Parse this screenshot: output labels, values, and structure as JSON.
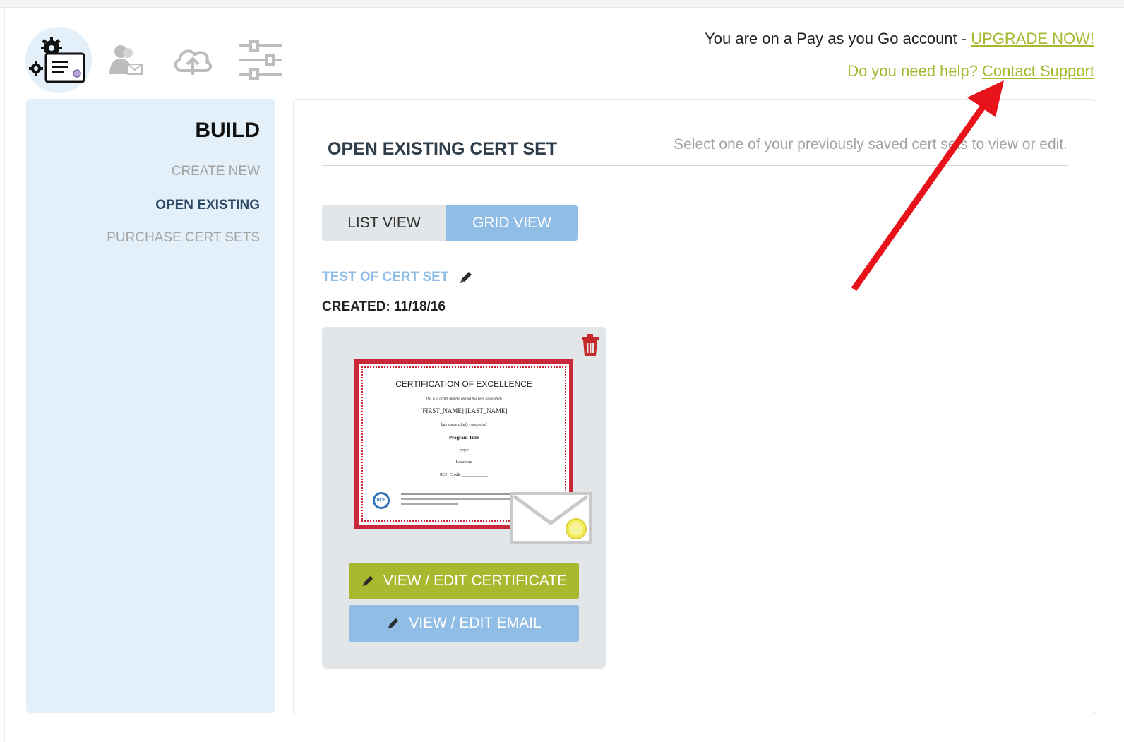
{
  "account": {
    "prefix": "You are on a Pay as you Go account - ",
    "upgrade_link": "UPGRADE NOW!"
  },
  "help": {
    "prefix": "Do you need help? ",
    "support_link": "Contact Support"
  },
  "nav": {
    "items": [
      {
        "icon": "build-certificate-icon",
        "active": true
      },
      {
        "icon": "recipients-icon",
        "active": false
      },
      {
        "icon": "cloud-upload-icon",
        "active": false
      },
      {
        "icon": "settings-sliders-icon",
        "active": false
      }
    ]
  },
  "sidebar": {
    "title": "BUILD",
    "items": [
      {
        "label": "CREATE NEW",
        "active": false
      },
      {
        "label": "OPEN EXISTING",
        "active": true
      },
      {
        "label": "PURCHASE CERT SETS",
        "active": false
      }
    ]
  },
  "panel": {
    "title": "OPEN EXISTING CERT SET",
    "description": "Select one of your previously saved cert sets to view or edit.",
    "views": {
      "list": "LIST VIEW",
      "grid": "GRID VIEW",
      "selected": "grid"
    }
  },
  "cert_set": {
    "name": "TEST OF CERT SET",
    "created": "CREATED: 11/18/16",
    "preview": {
      "title": "CERTIFICATION OF EXCELLENCE",
      "line1": "This is to certify that the cert set has been successfully",
      "line2": "[FIRST_NAME] [LAST_NAME]",
      "line3": "has successfully completed",
      "line4": "Program Title",
      "line5": "PPPP",
      "line6": "Location:",
      "line7": "RCH Credit: ____________",
      "seal": "RCH"
    },
    "view_edit_certificate": "VIEW / EDIT CERTIFICATE",
    "view_edit_email": "VIEW / EDIT EMAIL"
  },
  "colors": {
    "accent_green": "#a8b82f",
    "accent_blue": "#8fbde6",
    "sidebar_bg": "#e3eff9",
    "annotation_arrow": "#e8131a",
    "trash": "#c42a2a"
  }
}
